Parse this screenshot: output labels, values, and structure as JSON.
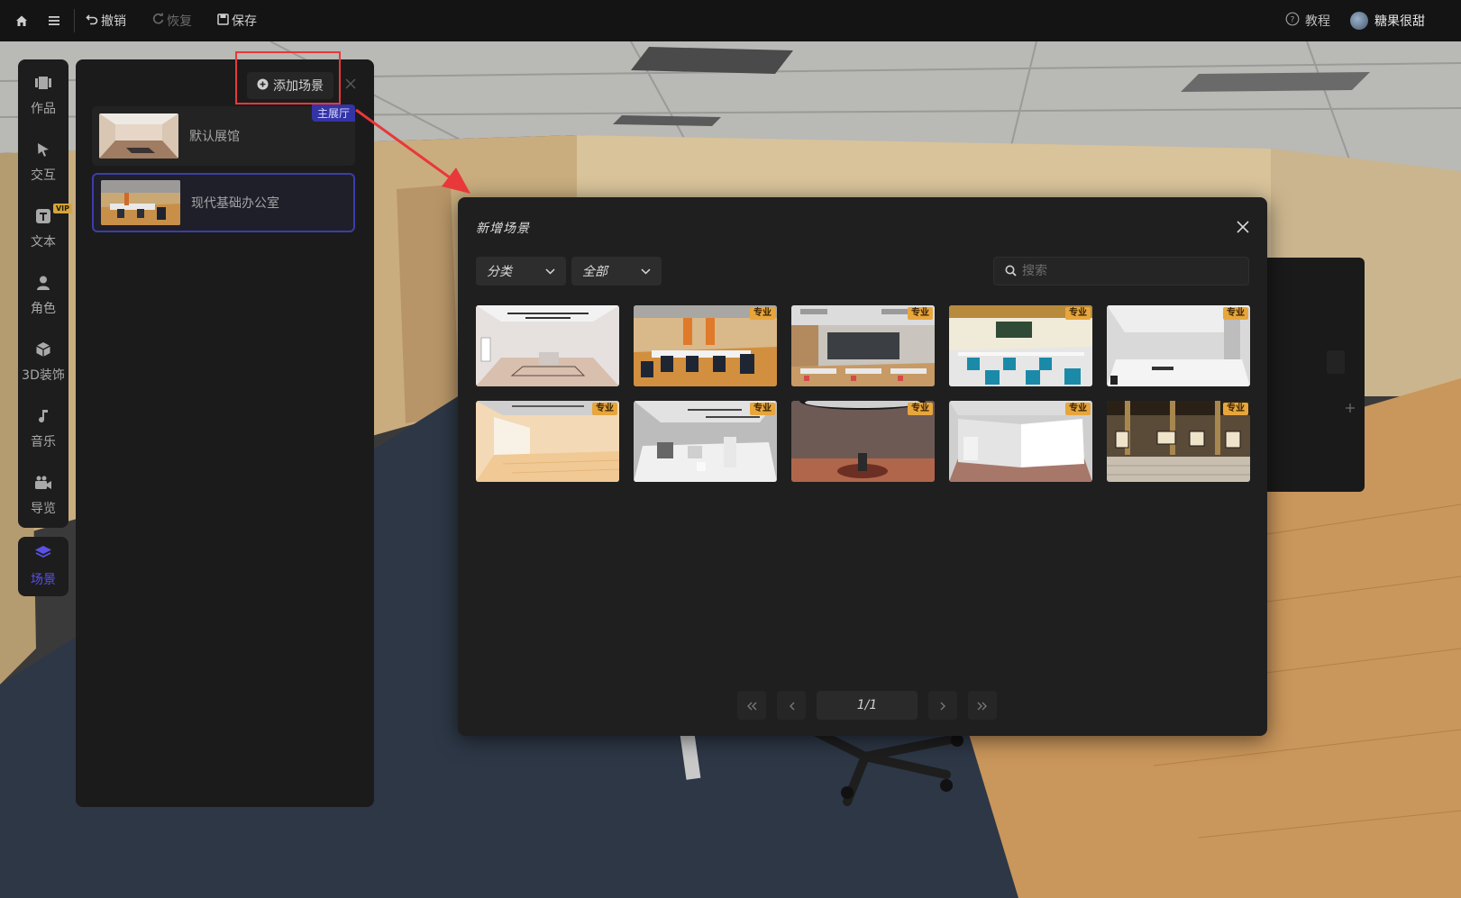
{
  "topbar": {
    "undo_label": "撤销",
    "redo_label": "恢复",
    "save_label": "保存",
    "tutorial_label": "教程",
    "username": "糖果很甜"
  },
  "sidebar": {
    "items": [
      {
        "label": "作品",
        "icon": "works-icon"
      },
      {
        "label": "交互",
        "icon": "pointer-icon"
      },
      {
        "label": "文本",
        "icon": "text-icon",
        "badge": "VIP"
      },
      {
        "label": "角色",
        "icon": "person-icon"
      },
      {
        "label": "3D装饰",
        "icon": "cube-icon"
      },
      {
        "label": "音乐",
        "icon": "music-icon"
      },
      {
        "label": "导览",
        "icon": "camera-icon"
      }
    ],
    "active": {
      "label": "场景",
      "icon": "layers-icon"
    }
  },
  "scene_panel": {
    "add_button_label": "添加场景",
    "scenes": [
      {
        "name": "默认展馆",
        "badge": "主展厅",
        "active": false
      },
      {
        "name": "现代基础办公室",
        "active": true
      }
    ]
  },
  "modal": {
    "title": "新增场景",
    "category_dropdown": "分类",
    "filter_dropdown": "全部",
    "search_placeholder": "搜索",
    "pro_badge": "专业",
    "templates": [
      {
        "theme": "white-gallery",
        "pro": false
      },
      {
        "theme": "office-orange",
        "pro": true
      },
      {
        "theme": "classroom-lecture",
        "pro": true
      },
      {
        "theme": "classroom-cyan",
        "pro": true
      },
      {
        "theme": "white-hall",
        "pro": true
      },
      {
        "theme": "warm-gallery",
        "pro": true
      },
      {
        "theme": "grey-studio",
        "pro": true
      },
      {
        "theme": "round-stage",
        "pro": true
      },
      {
        "theme": "white-box",
        "pro": true
      },
      {
        "theme": "classic-museum",
        "pro": true
      }
    ],
    "pagination": "1/1"
  },
  "colors": {
    "accent": "#5b51e6",
    "pro_badge": "#e7a63d",
    "highlight": "#e8383a",
    "main_badge": "#3334a6"
  }
}
